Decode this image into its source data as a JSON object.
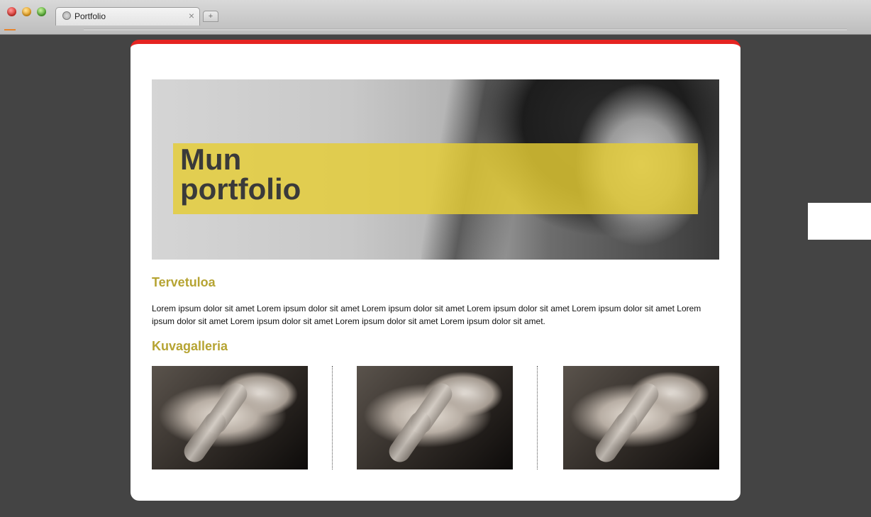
{
  "browser": {
    "tab_title": "Portfolio",
    "tab_close": "×",
    "new_tab": "+"
  },
  "page": {
    "accent_color": "#e52421",
    "heading_color": "#b6a433",
    "hero": {
      "title": "Mun\nportfolio",
      "band_color": "#e5cd35"
    },
    "welcome": {
      "heading": "Tervetuloa",
      "text": "Lorem ipsum dolor sit amet Lorem ipsum dolor sit amet Lorem ipsum dolor sit amet Lorem ipsum dolor sit amet Lorem ipsum dolor sit amet Lorem ipsum dolor sit amet Lorem ipsum dolor sit amet Lorem ipsum dolor sit amet Lorem ipsum dolor sit amet."
    },
    "gallery": {
      "heading": "Kuvagalleria",
      "images": [
        {
          "subject": "baby-hand-in-adult-hand"
        },
        {
          "subject": "baby-hand-in-adult-hand"
        },
        {
          "subject": "baby-hand-in-adult-hand"
        }
      ]
    }
  }
}
